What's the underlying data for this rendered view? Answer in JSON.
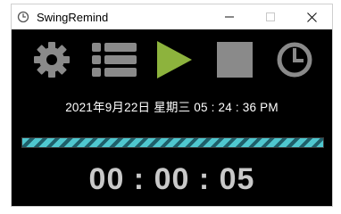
{
  "window": {
    "title": "SwingRemind"
  },
  "toolbar": {
    "icons": [
      "gear-icon",
      "list-icon",
      "play-icon",
      "stop-icon",
      "clock-icon"
    ],
    "colors": {
      "icon_gray": "#8a8a8a",
      "play_green": "#8db33d"
    }
  },
  "status": {
    "datetime": "2021年9月22日 星期三 05 : 24 : 36 PM"
  },
  "progress": {
    "percent": 100,
    "colors": [
      "#4fc7cf",
      "#1f5f6a"
    ]
  },
  "timer": {
    "text": "00 : 00 : 05"
  }
}
